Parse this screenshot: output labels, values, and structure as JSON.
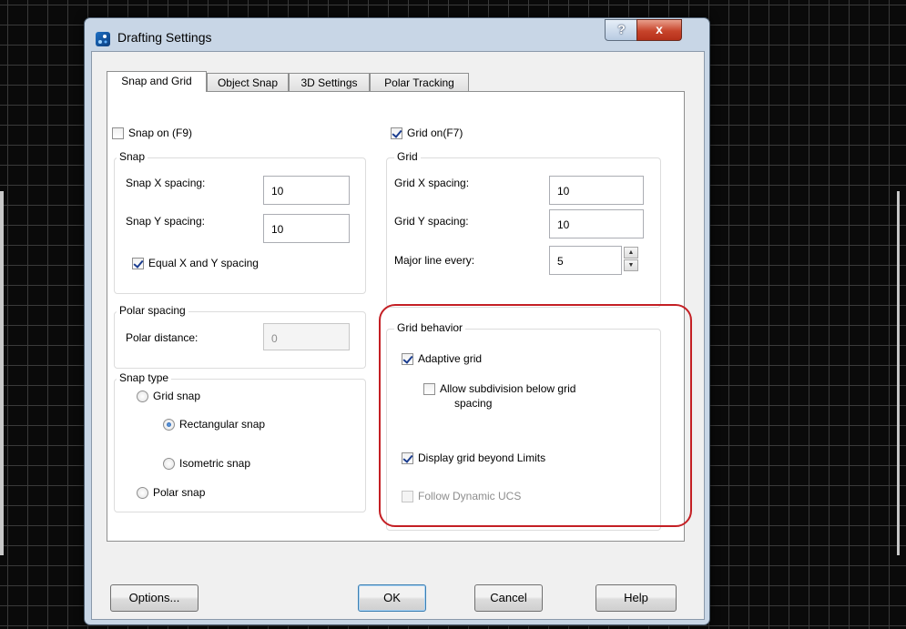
{
  "window": {
    "title": "Drafting Settings",
    "help_glyph": "?",
    "close_glyph": "x"
  },
  "tabs": [
    {
      "label": "Snap and Grid",
      "active": true
    },
    {
      "label": "Object Snap",
      "active": false
    },
    {
      "label": "3D Settings",
      "active": false
    },
    {
      "label": "Polar Tracking",
      "active": false
    }
  ],
  "snap_on": {
    "label": "Snap on (F9)",
    "checked": false
  },
  "grid_on": {
    "label": "Grid on(F7)",
    "checked": true
  },
  "snap": {
    "title": "Snap",
    "x_label": "Snap X spacing:",
    "x_value": "10",
    "y_label": "Snap Y spacing:",
    "y_value": "10",
    "equal_label": "Equal X and Y spacing",
    "equal_checked": true
  },
  "polar_spacing": {
    "title": "Polar spacing",
    "distance_label": "Polar distance:",
    "distance_value": "0"
  },
  "snap_type": {
    "title": "Snap type",
    "grid_snap": "Grid snap",
    "rectangular": "Rectangular snap",
    "isometric": "Isometric snap",
    "polar": "Polar snap",
    "selected": "Rectangular snap"
  },
  "grid": {
    "title": "Grid",
    "x_label": "Grid X spacing:",
    "x_value": "10",
    "y_label": "Grid Y spacing:",
    "y_value": "10",
    "major_label": "Major line every:",
    "major_value": "5"
  },
  "grid_behavior": {
    "title": "Grid behavior",
    "adaptive": {
      "label": "Adaptive grid",
      "checked": true
    },
    "subdivision": {
      "label_line1": "Allow subdivision below grid",
      "label_line2": "spacing",
      "checked": false
    },
    "beyond_limits": {
      "label": "Display grid beyond Limits",
      "checked": true
    },
    "follow_ucs": {
      "label": "Follow Dynamic UCS",
      "checked": false,
      "enabled": false
    }
  },
  "buttons": {
    "options": "Options...",
    "ok": "OK",
    "cancel": "Cancel",
    "help": "Help"
  },
  "colors": {
    "highlight": "#c41f24",
    "title_bar": "#c8d6e6",
    "close_button": "#c7442b"
  }
}
